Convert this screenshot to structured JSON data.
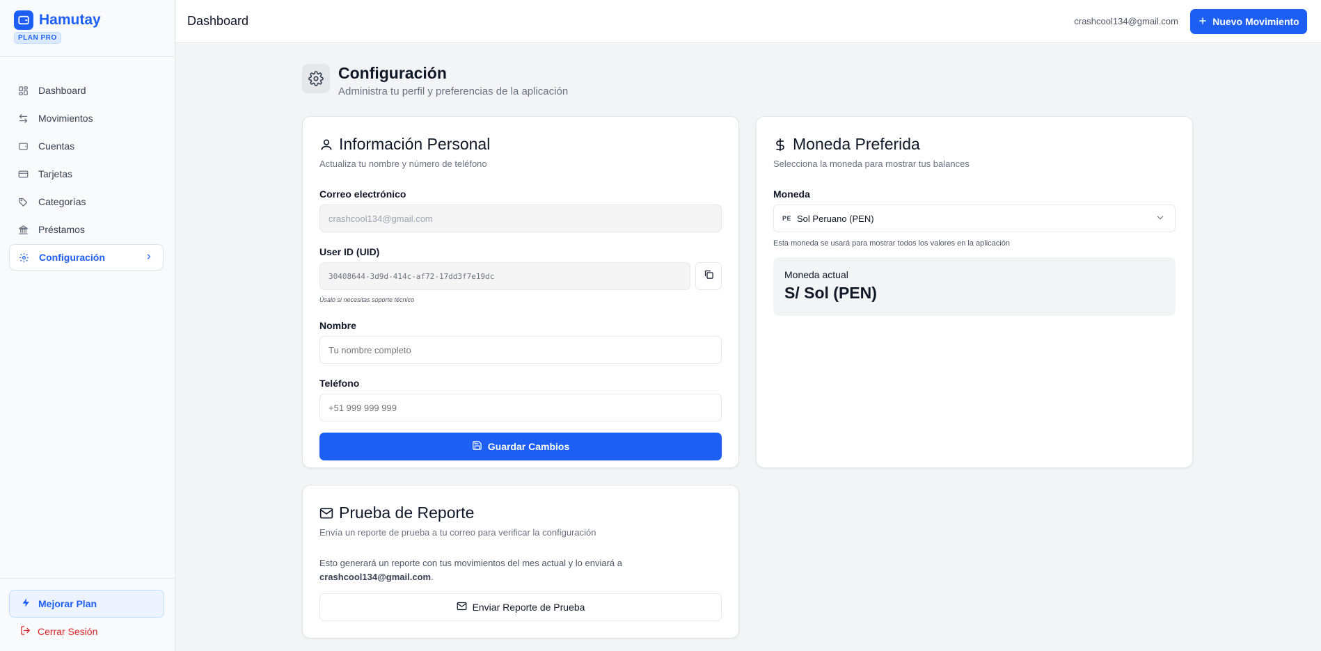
{
  "app": {
    "name": "Hamutay",
    "plan_badge": "PLAN PRO"
  },
  "sidebar": {
    "items": [
      {
        "label": "Dashboard",
        "icon": "layout-grid-icon"
      },
      {
        "label": "Movimientos",
        "icon": "arrows-left-right-icon"
      },
      {
        "label": "Cuentas",
        "icon": "wallet-icon"
      },
      {
        "label": "Tarjetas",
        "icon": "credit-card-icon"
      },
      {
        "label": "Categorías",
        "icon": "tag-icon"
      },
      {
        "label": "Préstamos",
        "icon": "bank-icon"
      },
      {
        "label": "Configuración",
        "icon": "gear-icon",
        "active": true
      }
    ],
    "upgrade_label": "Mejorar Plan",
    "logout_label": "Cerrar Sesión"
  },
  "header": {
    "title": "Dashboard",
    "user_email": "crashcool134@gmail.com",
    "new_button": "Nuevo Movimiento"
  },
  "page": {
    "title": "Configuración",
    "subtitle": "Administra tu perfil y preferencias de la aplicación"
  },
  "personal": {
    "title": "Información Personal",
    "description": "Actualiza tu nombre y número de teléfono",
    "email_label": "Correo electrónico",
    "email_value": "crashcool134@gmail.com",
    "uid_label": "User ID (UID)",
    "uid_value": "30408644-3d9d-414c-af72-17dd3f7e19dc",
    "uid_hint": "Úsalo si necesitas soporte técnico",
    "name_label": "Nombre",
    "name_placeholder": "Tu nombre completo",
    "phone_label": "Teléfono",
    "phone_placeholder": "+51 999 999 999",
    "save_button": "Guardar Cambios"
  },
  "currency": {
    "title": "Moneda Preferida",
    "description": "Selecciona la moneda para mostrar tus balances",
    "label": "Moneda",
    "flag_code": "PE",
    "selected": "Sol Peruano (PEN)",
    "hint": "Esta moneda se usará para mostrar todos los valores en la aplicación",
    "current_label": "Moneda actual",
    "current_value": "S/ Sol (PEN)"
  },
  "report": {
    "title": "Prueba de Reporte",
    "description": "Envía un reporte de prueba a tu correo para verificar la configuración",
    "body": "Esto generará un reporte con tus movimientos del mes actual y lo enviará a",
    "email": "crashcool134@gmail.com",
    "button": "Enviar Reporte de Prueba"
  },
  "colors": {
    "accent": "#1d5ff5",
    "danger": "#dc2626"
  }
}
